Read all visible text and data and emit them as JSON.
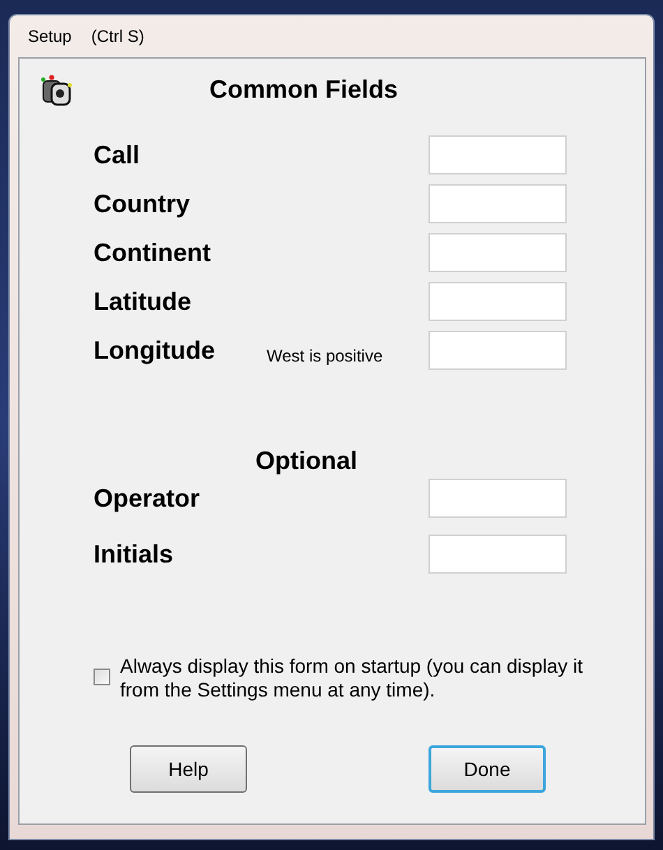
{
  "menu": {
    "title": "Setup",
    "shortcut": "(Ctrl S)"
  },
  "heading": "Common Fields",
  "fields": [
    {
      "label": "Call"
    },
    {
      "label": "Country"
    },
    {
      "label": "Continent"
    },
    {
      "label": "Latitude"
    },
    {
      "label": "Longitude",
      "note": "West is positive"
    }
  ],
  "optional": {
    "heading": "Optional",
    "fields": [
      {
        "label": "Operator"
      },
      {
        "label": "Initials"
      }
    ]
  },
  "startup_checkbox": {
    "label": "Always display this form on startup (you can display it from the Settings menu at any time).",
    "checked": false
  },
  "buttons": [
    {
      "label": "Help",
      "focused": false
    },
    {
      "label": "Done",
      "focused": true
    }
  ]
}
